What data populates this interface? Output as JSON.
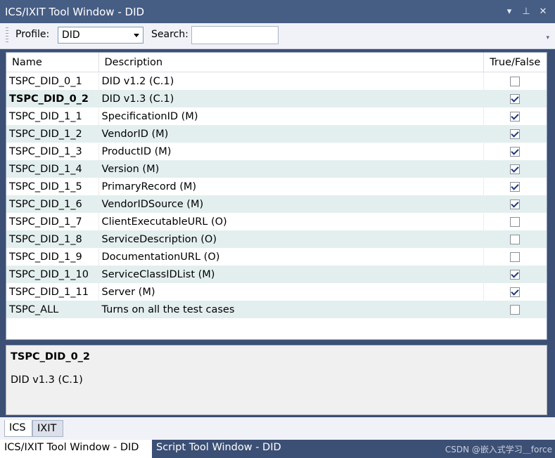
{
  "window": {
    "title": "ICS/IXIT Tool Window - DID",
    "controls": {
      "dropdown": "▾",
      "pin": "⊥",
      "close": "✕"
    }
  },
  "toolbar": {
    "profile_label": "Profile:",
    "profile_value": "DID",
    "search_label": "Search:",
    "search_value": "",
    "overflow": "▾"
  },
  "table": {
    "headers": {
      "name": "Name",
      "description": "Description",
      "truefalse": "True/False"
    },
    "rows": [
      {
        "name": "TSPC_DID_0_1",
        "description": "DID v1.2 (C.1)",
        "checked": false,
        "bold": false
      },
      {
        "name": "TSPC_DID_0_2",
        "description": "DID v1.3 (C.1)",
        "checked": true,
        "bold": true
      },
      {
        "name": "TSPC_DID_1_1",
        "description": "SpecificationID (M)",
        "checked": true,
        "bold": false
      },
      {
        "name": "TSPC_DID_1_2",
        "description": "VendorID (M)",
        "checked": true,
        "bold": false
      },
      {
        "name": "TSPC_DID_1_3",
        "description": "ProductID (M)",
        "checked": true,
        "bold": false
      },
      {
        "name": "TSPC_DID_1_4",
        "description": "Version (M)",
        "checked": true,
        "bold": false
      },
      {
        "name": "TSPC_DID_1_5",
        "description": "PrimaryRecord (M)",
        "checked": true,
        "bold": false
      },
      {
        "name": "TSPC_DID_1_6",
        "description": "VendorIDSource (M)",
        "checked": true,
        "bold": false
      },
      {
        "name": "TSPC_DID_1_7",
        "description": "ClientExecutableURL (O)",
        "checked": false,
        "bold": false
      },
      {
        "name": "TSPC_DID_1_8",
        "description": "ServiceDescription (O)",
        "checked": false,
        "bold": false
      },
      {
        "name": "TSPC_DID_1_9",
        "description": "DocumentationURL (O)",
        "checked": false,
        "bold": false
      },
      {
        "name": "TSPC_DID_1_10",
        "description": "ServiceClassIDList (M)",
        "checked": true,
        "bold": false
      },
      {
        "name": "TSPC_DID_1_11",
        "description": "Server (M)",
        "checked": true,
        "bold": false
      },
      {
        "name": "TSPC_ALL",
        "description": "Turns on all the test cases",
        "checked": false,
        "bold": false
      }
    ]
  },
  "detail": {
    "title": "TSPC_DID_0_2",
    "description": "DID v1.3 (C.1)"
  },
  "tabs": [
    {
      "label": "ICS",
      "active": true
    },
    {
      "label": "IXIT",
      "active": false
    }
  ],
  "bottom_tabs": [
    {
      "label": "ICS/IXIT Tool Window - DID",
      "active": true
    },
    {
      "label": "Script Tool Window - DID",
      "active": false
    }
  ],
  "watermark": "CSDN @嵌入式学习＿force",
  "colors": {
    "accent": "#465d84",
    "alt_row": "#e3efee",
    "check": "#1f3a7a"
  }
}
